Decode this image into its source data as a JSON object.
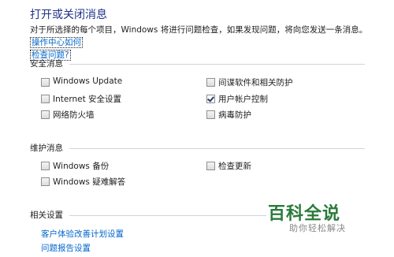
{
  "page_title": "打开或关闭消息",
  "description_prefix": "对于所选择的每个项目，Windows 将进行问题检查，如果发现问题，将向您发送一条消息。",
  "description_link_line1": "操作中心如何",
  "description_link_line2": "检查问题?",
  "security": {
    "heading": "安全消息",
    "items": [
      {
        "label": "Windows Update",
        "checked": false
      },
      {
        "label": "间谍软件和相关防护",
        "checked": false
      },
      {
        "label": "Internet 安全设置",
        "checked": false
      },
      {
        "label": "用户帐户控制",
        "checked": true
      },
      {
        "label": "网络防火墙",
        "checked": false
      },
      {
        "label": "病毒防护",
        "checked": false
      }
    ]
  },
  "maintenance": {
    "heading": "维护消息",
    "items": [
      {
        "label": "Windows 备份",
        "checked": false
      },
      {
        "label": "检查更新",
        "checked": false
      },
      {
        "label": "Windows 疑难解答",
        "checked": false
      }
    ]
  },
  "related": {
    "heading": "相关设置",
    "links": [
      "客户体验改善计划设置",
      "问题报告设置"
    ]
  },
  "watermark": {
    "title": "百科全说",
    "subtitle": "助你轻松解决"
  }
}
